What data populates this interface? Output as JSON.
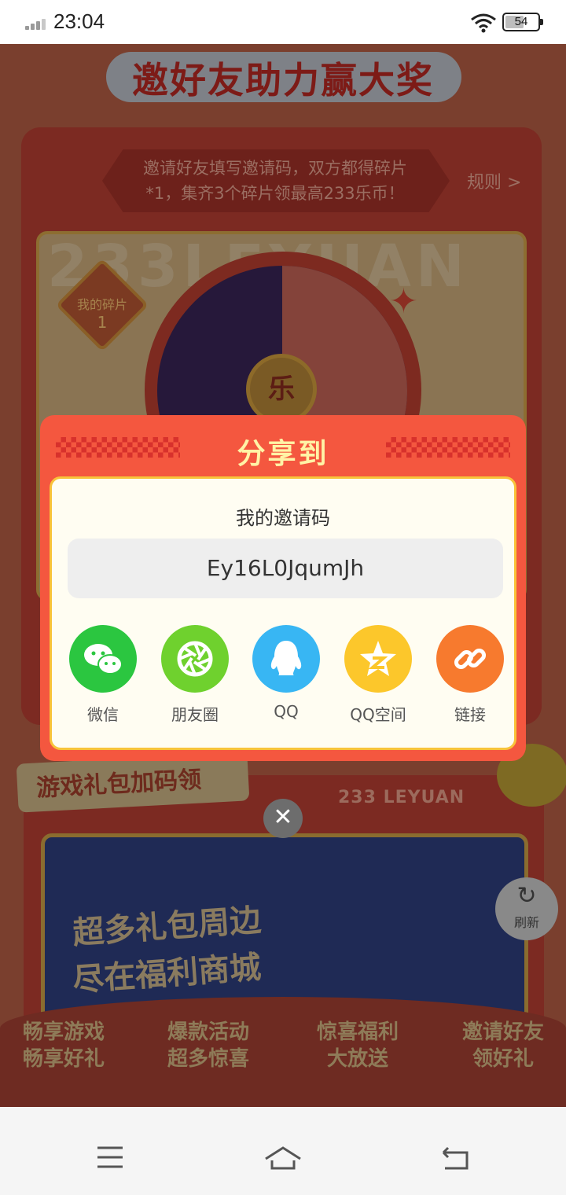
{
  "status_bar": {
    "time": "23:04",
    "battery": "54"
  },
  "background": {
    "banner_title": "邀好友助力赢大奖",
    "ribbon_line1": "邀请好友填写邀请码，双方都得碎片",
    "ribbon_line2": "*1，集齐3个碎片领最高233乐币！",
    "rules_link": "规则 >",
    "watermark": "233LEYUAN",
    "fragment_label": "我的碎片",
    "fragment_count": "1",
    "wheel_badge": "乐",
    "section2_title": "游戏礼包加码领",
    "section2_brand": "233 LEYUAN",
    "promo_line1": "超多礼包周边",
    "promo_line2": "尽在福利商城",
    "refresh_label": "刷新",
    "features": [
      {
        "line1": "畅享游戏",
        "line2": "畅享好礼"
      },
      {
        "line1": "爆款活动",
        "line2": "超多惊喜"
      },
      {
        "line1": "惊喜福利",
        "line2": "大放送"
      },
      {
        "line1": "邀请好友",
        "line2": "领好礼"
      }
    ]
  },
  "modal": {
    "title": "分享到",
    "code_label": "我的邀请码",
    "invite_code": "Ey16L0JqumJh",
    "share_options": [
      {
        "label": "微信",
        "icon": "wechat-icon",
        "color": "#2bc640"
      },
      {
        "label": "朋友圈",
        "icon": "moments-icon",
        "color": "#6fd12e"
      },
      {
        "label": "QQ",
        "icon": "qq-icon",
        "color": "#38b6f3"
      },
      {
        "label": "QQ空间",
        "icon": "qzone-icon",
        "color": "#fcc72b"
      },
      {
        "label": "链接",
        "icon": "link-icon",
        "color": "#f77a2e"
      }
    ],
    "close_glyph": "✕"
  },
  "colors": {
    "modal_bg": "#f4573f",
    "modal_title": "#fff3a6",
    "modal_inner_bg": "#fffdf2",
    "overlay_bg": "#7a3f2e"
  }
}
